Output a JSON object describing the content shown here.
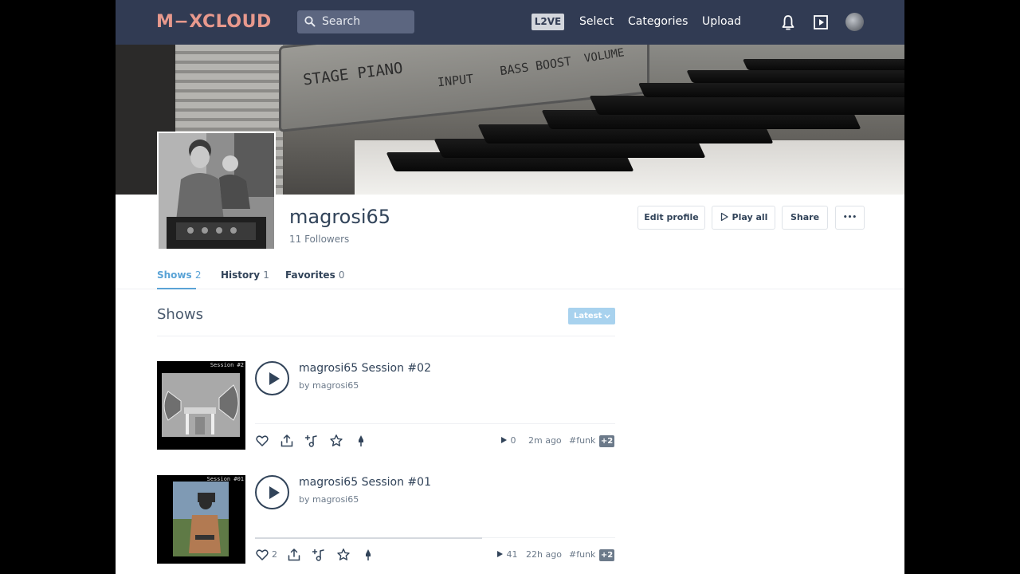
{
  "header": {
    "logo_text": "M−XCLOUD",
    "search_placeholder": "Search",
    "live_label": "L2VE",
    "nav": [
      "Select",
      "Categories",
      "Upload"
    ],
    "icons": [
      "bell-icon",
      "play-square-icon",
      "user-avatar"
    ]
  },
  "cover": {
    "panel_labels": [
      "STAGE PIANO",
      "INPUT",
      "BASS BOOST",
      "VOLUME"
    ]
  },
  "profile": {
    "username": "magrosi65",
    "followers": "11 Followers",
    "buttons": {
      "edit": "Edit profile",
      "play_all": "Play all",
      "share": "Share",
      "more": "•••"
    }
  },
  "tabs": [
    {
      "label": "Shows",
      "count": "2",
      "active": true
    },
    {
      "label": "History",
      "count": "1",
      "active": false
    },
    {
      "label": "Favorites",
      "count": "0",
      "active": false
    }
  ],
  "section": {
    "title": "Shows",
    "sort_label": "Latest"
  },
  "shows": [
    {
      "art_label": "Session #2",
      "title": "magrosi65 Session #02",
      "byline": "by magrosi65",
      "likes": "",
      "plays": "0",
      "age": "2m ago",
      "tag": "#funk",
      "more_tags": "+2",
      "progress": 0
    },
    {
      "art_label": "Session #01",
      "title": "magrosi65 Session #01",
      "byline": "by magrosi65",
      "likes": "2",
      "plays": "41",
      "age": "22h ago",
      "tag": "#funk",
      "more_tags": "+2",
      "progress": 0.63
    }
  ],
  "colors": {
    "header_bg": "#313b53",
    "logo": "#e8998d",
    "accent": "#5aa3d6"
  }
}
